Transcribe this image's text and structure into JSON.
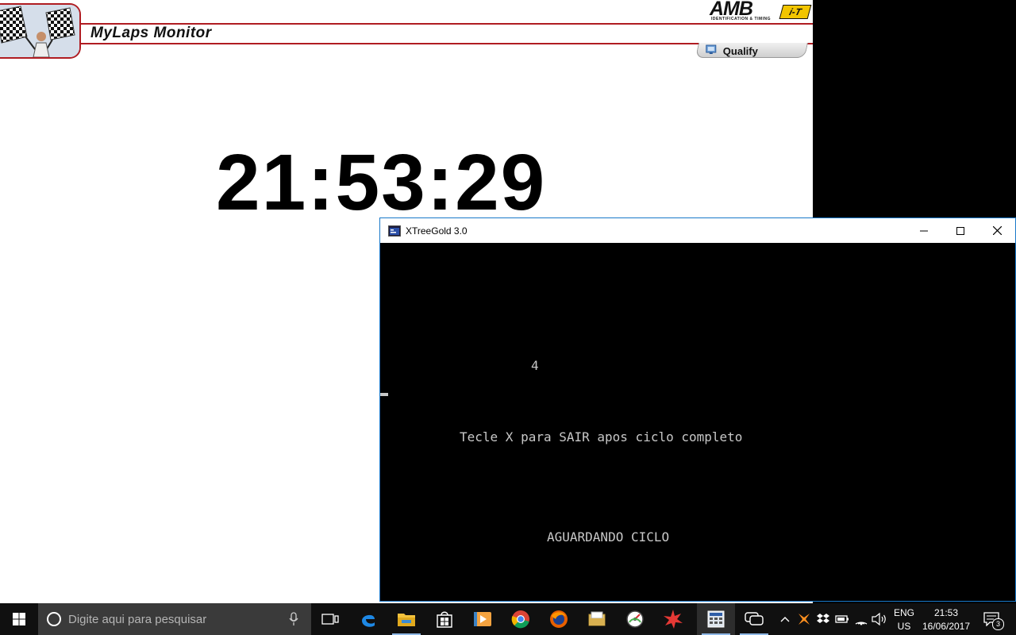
{
  "mylaps": {
    "title": "MyLaps Monitor",
    "brand": "AMB",
    "brand_badge": "i-T",
    "brand_sub": "IDENTIFICATION & TIMING",
    "qualify_label": "Qualify",
    "clock": "21:53:29",
    "accent_color": "#b01c22"
  },
  "xtree": {
    "window_title": "XTreeGold 3.0",
    "console": {
      "counter": "4",
      "instruction": "Tecle X para SAIR apos ciclo completo",
      "status": "AGUARDANDO CICLO"
    }
  },
  "taskbar": {
    "search_placeholder": "Digite aqui para pesquisar",
    "pinned": [
      "task-view-icon",
      "edge-icon",
      "file-explorer-icon",
      "store-icon",
      "media-player-icon",
      "chrome-icon",
      "firefox-icon",
      "folder-app-icon",
      "speedometer-icon",
      "red-star-icon",
      "calculator-window-icon",
      "chat-icon"
    ],
    "tray": {
      "language": "ENG",
      "layout": "US",
      "time": "21:53",
      "date": "16/06/2017",
      "notification_count": "3"
    }
  }
}
